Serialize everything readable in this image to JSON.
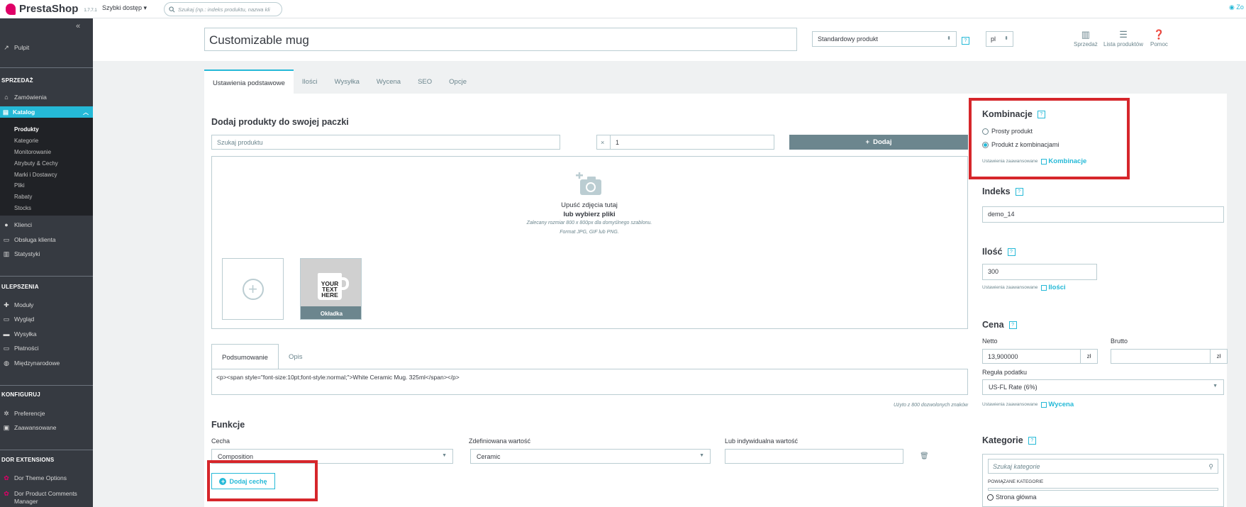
{
  "topbar": {
    "brand": "PrestaShop",
    "version": "1.7.7.1",
    "quick_access": "Szybki dostęp ▾",
    "search_placeholder": "Szukaj (np.: indeks produktu, nazwa kli",
    "view_shop": "Zo"
  },
  "sidebar": {
    "collapse_icon": "«",
    "pulpit": "Pulpit",
    "sections": {
      "sales": "SPRZEDAŻ",
      "improvements": "ULEPSZENIA",
      "configure": "KONFIGURUJ",
      "extensions": "DOR EXTENSIONS"
    },
    "zamowienia": "Zamówienia",
    "katalog": "Katalog",
    "katalog_items": [
      "Produkty",
      "Kategorie",
      "Monitorowanie",
      "Atrybuty & Cechy",
      "Marki i Dostawcy",
      "Pliki",
      "Rabaty",
      "Stocks"
    ],
    "klienci": "Klienci",
    "obsluga": "Obsługa klienta",
    "statystyki": "Statystyki",
    "moduly": "Moduły",
    "wyglad": "Wygląd",
    "wysylka": "Wysyłka",
    "platnosci": "Płatności",
    "miedzynarodowe": "Międzynarodowe",
    "preferencje": "Preferencje",
    "zaawansowane": "Zaawansowane",
    "dor_theme": "Dor Theme Options",
    "dor_comments_1": "Dor Product Comments",
    "dor_comments_2": "Manager"
  },
  "header": {
    "product_name": "Customizable mug",
    "product_type": "Standardowy produkt",
    "help": "?",
    "lang": "pl",
    "tools": {
      "sales": "Sprzedaż",
      "product_list": "Lista produktów",
      "help": "Pomoc"
    }
  },
  "tabs": [
    "Ustawienia podstawowe",
    "Ilości",
    "Wysyłka",
    "Wycena",
    "SEO",
    "Opcje"
  ],
  "pack": {
    "title": "Dodaj produkty do swojej paczki",
    "search_placeholder": "Szukaj produktu",
    "times": "×",
    "qty": "1",
    "add_label": "Dodaj",
    "add_icon": "+"
  },
  "dropzone": {
    "line1": "Upuść zdjęcia tutaj",
    "line2": "lub wybierz pliki",
    "line3": "Zalecany rozmiar 800 x 800px dla domyślnego szablonu.",
    "line4": "Format JPG, GIF lub PNG.",
    "plus": "+",
    "mug_text": "YOUR TEXT HERE",
    "cover_label": "Okładka"
  },
  "description": {
    "tab_summary": "Podsumowanie",
    "tab_desc": "Opis",
    "summary_value": "<p><span style=\"font-size:10pt;font-style:normal;\">White Ceramic Mug. 325ml</span></p>",
    "counter": "Użyto z 800 dozwolonych znaków"
  },
  "features": {
    "title": "Funkcje",
    "feature_label": "Cecha",
    "predefined_label": "Zdefiniowana wartość",
    "custom_label": "Lub indywidualna wartość",
    "feature_value": "Composition",
    "predefined_value": "Ceramic",
    "custom_value": "",
    "add_button": "Dodaj cechę",
    "add_icon": "+"
  },
  "right": {
    "combinations_title": "Kombinacje",
    "help": "?",
    "simple_product": "Prosty produkt",
    "with_combinations": "Produkt z kombinacjami",
    "selected_option": "Produkt z kombinacjami",
    "advanced_settings": "Ustawienia zaawansowane",
    "combinations_link": "Kombinacje",
    "reference_title": "Indeks",
    "reference_value": "demo_14",
    "quantity_title": "Ilość",
    "quantity_value": "300",
    "quantities_link": "Ilości",
    "price_title": "Cena",
    "netto_label": "Netto",
    "brutto_label": "Brutto",
    "netto_value": "13,900000",
    "brutto_value": "",
    "currency": "zł",
    "tax_rule_label": "Reguła podatku",
    "tax_rule_value": "US-FL Rate (6%)",
    "pricing_link": "Wycena",
    "categories_title": "Kategorie",
    "categories_search_placeholder": "Szukaj kategorie",
    "associated_label": "POWIĄZANE KATEGORIE",
    "root_category": "Strona główna"
  },
  "colors": {
    "accent": "#25b9d7",
    "sidebar_bg": "#363a41",
    "highlight_red": "#d6262b",
    "gray_button": "#6c868e"
  }
}
